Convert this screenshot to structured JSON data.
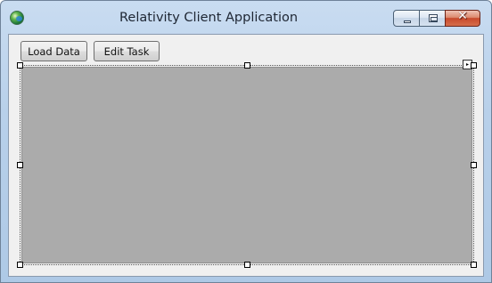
{
  "window": {
    "title": "Relativity Client Application",
    "icon": "relativity-globe-icon"
  },
  "caption_buttons": {
    "minimize_icon": "minimize-icon",
    "maximize_icon": "restore-icon",
    "close_icon": "close-icon",
    "close_glyph": "✕"
  },
  "toolbar": {
    "load_label": "Load Data",
    "edit_label": "Edit Task"
  },
  "designer": {
    "panel_color": "#ababab",
    "selection": "selected",
    "smart_tag_glyph": "▸"
  },
  "colors": {
    "titlebar": "#b8d0ea",
    "client": "#f0f0f0",
    "close_button": "#c84a2c"
  }
}
